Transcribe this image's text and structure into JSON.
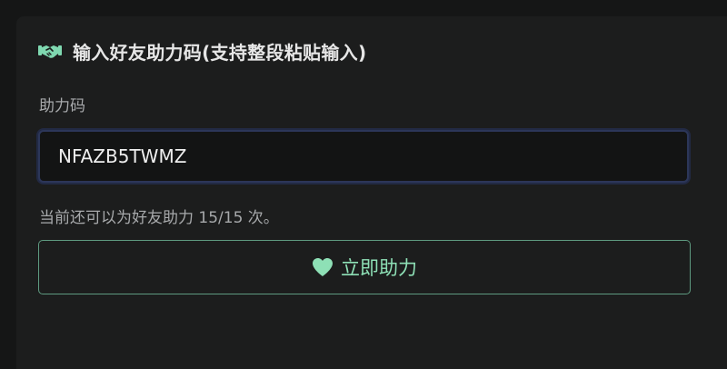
{
  "section": {
    "title": "输入好友助力码(支持整段粘贴输入)",
    "title_icon": "handshake-icon"
  },
  "form": {
    "code_label": "助力码",
    "code_value": "NFAZB5TWMZ",
    "remaining_text": "当前还可以为好友助力 15/15 次。"
  },
  "action": {
    "button_label": "立即助力",
    "button_icon": "heart-icon"
  },
  "colors": {
    "accent": "#8ee0b6",
    "button_border": "#5e9a80",
    "input_border": "#2c3659",
    "background": "#1c1d1d"
  }
}
